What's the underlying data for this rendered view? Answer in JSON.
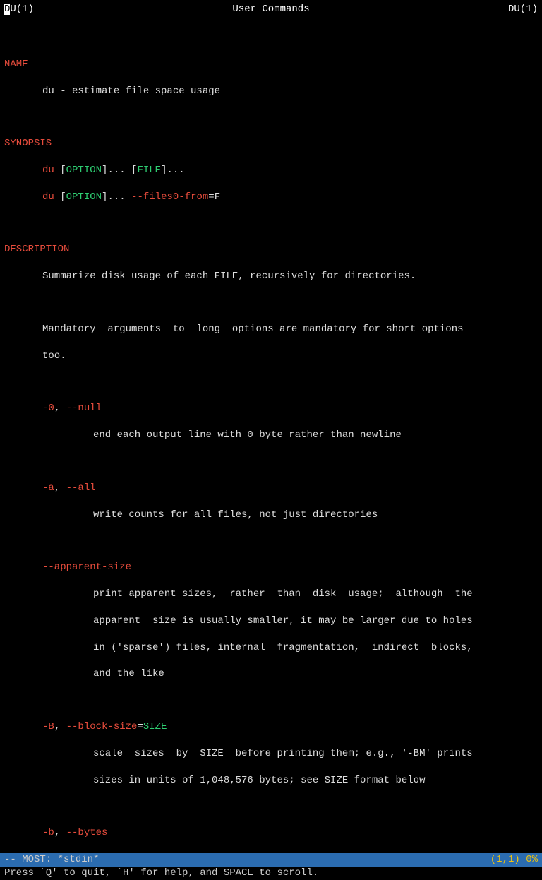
{
  "header": {
    "left_highlighted": "D",
    "left_rest": "U(1)",
    "center": "User Commands",
    "right": "DU(1)"
  },
  "sections": {
    "name_heading": "NAME",
    "name_text": "du - estimate file space usage",
    "synopsis_heading": "SYNOPSIS",
    "synopsis_line1_cmd": "du",
    "synopsis_line1_opt": "OPTION",
    "synopsis_line1_rest": "]... [",
    "synopsis_line1_file": "FILE",
    "synopsis_line1_end": "]...",
    "synopsis_line2_cmd": "du",
    "synopsis_line2_opt": "OPTION",
    "synopsis_line2_rest": "]... ",
    "synopsis_line2_flag": "--files0-from",
    "synopsis_line2_eq": "=",
    "synopsis_line2_arg": "F",
    "description_heading": "DESCRIPTION",
    "description_para1": "Summarize disk usage of each FILE, recursively for directories.",
    "description_para2a": "Mandatory  arguments  to  long  options are mandatory for short options",
    "description_para2b": "too.",
    "opt_null_short": "-0",
    "opt_null_long": "--null",
    "opt_null_desc": "end each output line with 0 byte rather than newline",
    "opt_all_short": "-a",
    "opt_all_long": "--all",
    "opt_all_desc": "write counts for all files, not just directories",
    "opt_apparent_long": "--apparent-size",
    "opt_apparent_desc1": "print apparent sizes,  rather  than  disk  usage;  although  the",
    "opt_apparent_desc2": "apparent  size is usually smaller, it may be larger due to holes",
    "opt_apparent_desc3": "in ('sparse') files, internal  fragmentation,  indirect  blocks,",
    "opt_apparent_desc4": "and the like",
    "opt_blocksize_short": "-B",
    "opt_blocksize_long": "--block-size",
    "opt_blocksize_eq": "=",
    "opt_blocksize_arg": "SIZE",
    "opt_blocksize_desc1": "scale  sizes  by  SIZE  before printing them; e.g., '-BM' prints",
    "opt_blocksize_desc2": "sizes in units of 1,048,576 bytes; see SIZE format below",
    "opt_bytes_short": "-b",
    "opt_bytes_long": "--bytes",
    "comma": ", "
  },
  "status": {
    "left": "-- MOST: *stdin*",
    "right": "(1,1) 0%"
  },
  "help": "Press `Q' to quit, `H' for help, and SPACE to scroll."
}
